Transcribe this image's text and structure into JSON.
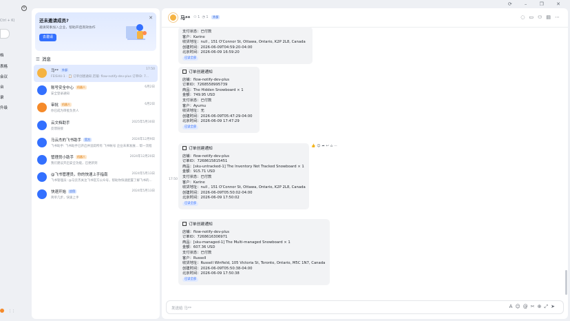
{
  "window": {
    "controls": [
      "⟳",
      "–",
      "❐",
      "✕"
    ]
  },
  "leftstrip": {
    "shortcut": "Ctrl + K)",
    "items": [
      "档",
      "表格",
      "会议",
      "台",
      "录",
      "升级"
    ]
  },
  "invite": {
    "title": "还未邀请成员?",
    "desc": "邀请同事加入企业，帮助开启高效协作",
    "button": "去邀请"
  },
  "messages_header": "消息",
  "chats": [
    {
      "name": "马**",
      "tag": "外部",
      "tag_color": "blue",
      "preview": "FEISHU-1 · 📋 订单创建通知 店铺: flow-notify-dev-plus 订单ID: 7...",
      "time": "17:50",
      "active": true,
      "avatar_color": "#f5b342"
    },
    {
      "name": "账号安全中心",
      "tag": "机器人",
      "tag_color": "orange",
      "preview": "安全登录通知",
      "time": "6月2日",
      "avatar_color": "#3370ff"
    },
    {
      "name": "审批",
      "tag": "机器人",
      "tag_color": "orange",
      "preview": "你已成为审批负责人",
      "time": "6月2日",
      "avatar_color": "#f58a2a"
    },
    {
      "name": "云文档助手",
      "tag": "",
      "tag_color": "",
      "preview": "反馈链接",
      "time": "2025年5月30日",
      "avatar_color": "#3370ff"
    },
    {
      "name": "马云杰的飞书助手",
      "tag": "官方",
      "tag_color": "blue",
      "preview": "飞书助手: 飞书助手已开启并追踪所有 飞书帐号 企业未来发展... 帮一流程",
      "time": "2024年12月9日",
      "avatar_color": "#3370ff"
    },
    {
      "name": "管理员小助手",
      "tag": "机器人",
      "tag_color": "orange",
      "preview": "我们建议开启安全功能，已更新到",
      "time": "2024年12月20日",
      "avatar_color": "#3370ff"
    },
    {
      "name": "@飞书管理员，你的快速上手指南",
      "tag": "",
      "tag_color": "",
      "preview": "飞书管理员: @马云杰关注飞书官方公众号，帮助你快速配置了解飞书的...",
      "time": "2024年5月13日",
      "avatar_color": "#3370ff"
    },
    {
      "name": "快速开始",
      "tag": "应用",
      "tag_color": "blue",
      "preview": "简单几步，快速上手",
      "time": "2024年5月13日",
      "avatar_color": "#3370ff"
    }
  ],
  "conversation": {
    "name": "马**",
    "members": "1",
    "online": "1",
    "tag": "外部",
    "time_stamp": "17:50",
    "input_placeholder": "发送给 马**"
  },
  "bubbles": [
    {
      "title": "",
      "lines": [
        "支付状态：已付款",
        "客户：Karine",
        "收货地址：null , 151 O'Connor St, Ottawa, Ontario, K2P 2L8, Canada",
        "创建时间：2026-06-09T04:59:20-04:00",
        "北京时间：2026-06-09 16:59:20"
      ],
      "read": "已读全部"
    },
    {
      "title": "订单创建通知",
      "lines": [
        "店铺：flow-notify-dev-plus",
        "订单ID：7268558995739",
        "商品：The Hidden Snowboard × 1",
        "金额：749.95 USD",
        "支付状态：已付款",
        "客户：Ayumu",
        "收货地址：无",
        "创建时间：2026-06-09T05:47:29-04:00",
        "北京时间：2026-06-09 17:47:29"
      ],
      "read": "已读全部"
    },
    {
      "title": "订单创建通知",
      "lines": [
        "店铺：flow-notify-dev-plus",
        "订单ID：7268615815451",
        "商品：[sku-untracked-1] The Inventory Not Tracked Snowboard × 1",
        "金额：915.71 USD",
        "支付状态：已付款",
        "客户：Karine",
        "收货地址：null , 151 O'Connor St, Ottawa, Ontario, K2P 2L8, Canada",
        "创建时间：2026-06-09T05:50:02-04:00",
        "北京时间：2026-06-09 17:50:02"
      ],
      "read": "已读全部"
    },
    {
      "title": "订单创建通知",
      "lines": [
        "店铺：flow-notify-dev-plus",
        "订单ID：7268616306971",
        "商品：[sku-managed-1] The Multi-managed Snowboard × 1",
        "金额：607.36 USD",
        "支付状态：已付款",
        "客户：Russell",
        "收货地址：Russell Winfield, 105 Victoria St, Toronto, Ontario, M5C 1N7, Canada",
        "创建时间：2026-06-09T05:50:38-04:00",
        "北京时间：2026-06-09 17:50:38"
      ],
      "read": "已读全部"
    }
  ]
}
